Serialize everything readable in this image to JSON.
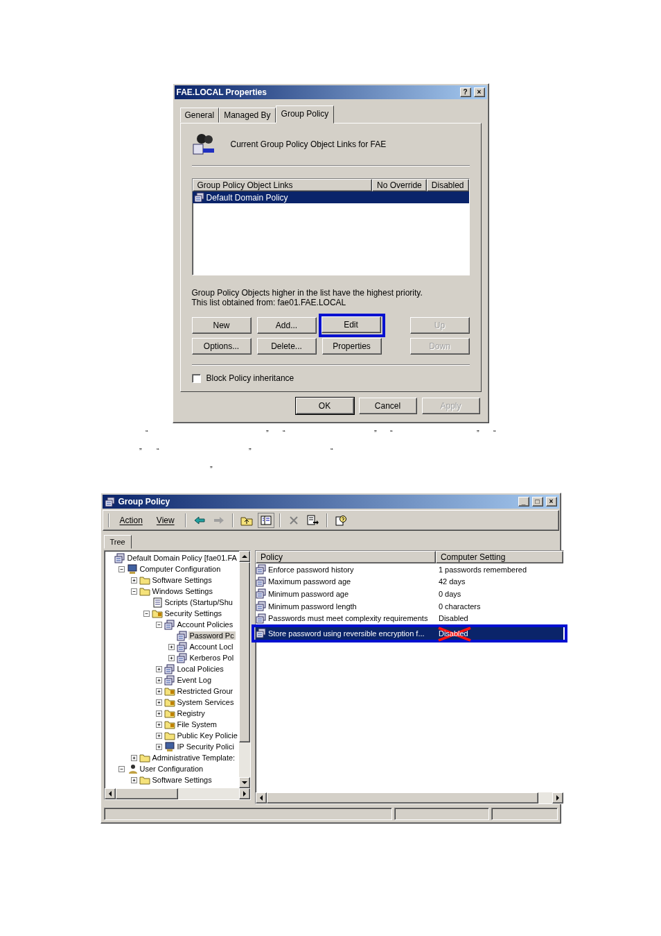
{
  "dialog": {
    "title": "FAE.LOCAL Properties",
    "title_buttons": [
      "?",
      "×"
    ],
    "tabs": [
      {
        "label": "General",
        "selected": false
      },
      {
        "label": "Managed By",
        "selected": false
      },
      {
        "label": "Group Policy",
        "selected": true
      }
    ],
    "heading": "Current Group Policy Object Links for FAE",
    "links_table": {
      "columns": [
        "Group Policy Object Links",
        "No Override",
        "Disabled"
      ],
      "rows": [
        {
          "name": "Default Domain Policy",
          "selected": true
        }
      ]
    },
    "notes": [
      "Group Policy Objects higher in the list have the highest priority.",
      "This list obtained from: fae01.FAE.LOCAL"
    ],
    "button_rows": [
      [
        {
          "label": "New",
          "disabled": false
        },
        {
          "label": "Add...",
          "disabled": false
        },
        {
          "label": "Edit",
          "disabled": false,
          "annotated": true
        },
        {
          "label": "Up",
          "disabled": true
        }
      ],
      [
        {
          "label": "Options...",
          "disabled": false
        },
        {
          "label": "Delete...",
          "disabled": false
        },
        {
          "label": "Properties",
          "disabled": false
        },
        {
          "label": "Down",
          "disabled": true
        }
      ]
    ],
    "block_inheritance": {
      "label": "Block Policy inheritance",
      "checked": false
    },
    "footer_buttons": [
      {
        "label": "OK",
        "default": true,
        "disabled": false
      },
      {
        "label": "Cancel",
        "default": false,
        "disabled": false
      },
      {
        "label": "Apply",
        "default": false,
        "disabled": true
      }
    ]
  },
  "quote_lines": [
    [
      "“",
      "”",
      "“",
      "”",
      "“",
      "”",
      "“"
    ],
    [
      "”",
      "“",
      "”",
      "“"
    ],
    [
      "”"
    ]
  ],
  "gp_window": {
    "title": "Group Policy",
    "title_buttons": [
      "_",
      "□",
      "×"
    ],
    "menu": [
      "Action",
      "View"
    ],
    "tree_tab": "Tree",
    "tree": [
      {
        "label": "Default Domain Policy [fae01.FA",
        "kind": "policy",
        "selected": false,
        "children": [
          {
            "label": "Computer Configuration",
            "kind": "computer",
            "expanded": true,
            "selected": false,
            "children": [
              {
                "label": "Software Settings",
                "kind": "folder",
                "expanded": false,
                "selected": false
              },
              {
                "label": "Windows Settings",
                "kind": "folder",
                "expanded": true,
                "selected": false,
                "children": [
                  {
                    "label": "Scripts (Startup/Shu",
                    "kind": "script",
                    "selected": false
                  },
                  {
                    "label": "Security Settings",
                    "kind": "secure",
                    "expanded": true,
                    "selected": false,
                    "children": [
                      {
                        "label": "Account Policies",
                        "kind": "policy",
                        "expanded": true,
                        "selected": false,
                        "children": [
                          {
                            "label": "Password Pc",
                            "kind": "policy",
                            "selected": true
                          },
                          {
                            "label": "Account Locl",
                            "kind": "policy",
                            "expanded": false,
                            "selected": false
                          },
                          {
                            "label": "Kerberos Pol",
                            "kind": "policy",
                            "expanded": false,
                            "selected": false
                          }
                        ]
                      },
                      {
                        "label": "Local Policies",
                        "kind": "policy",
                        "expanded": false,
                        "selected": false
                      },
                      {
                        "label": "Event Log",
                        "kind": "policy",
                        "expanded": false,
                        "selected": false
                      },
                      {
                        "label": "Restricted Grour",
                        "kind": "secure",
                        "expanded": false,
                        "selected": false
                      },
                      {
                        "label": "System Services",
                        "kind": "secure",
                        "expanded": false,
                        "selected": false
                      },
                      {
                        "label": "Registry",
                        "kind": "secure",
                        "expanded": false,
                        "selected": false
                      },
                      {
                        "label": "File System",
                        "kind": "secure",
                        "expanded": false,
                        "selected": false
                      },
                      {
                        "label": "Public Key Policie",
                        "kind": "folder",
                        "expanded": false,
                        "selected": false
                      },
                      {
                        "label": "IP Security Polici",
                        "kind": "computer",
                        "expanded": false,
                        "selected": false
                      }
                    ]
                  }
                ]
              },
              {
                "label": "Administrative Template:",
                "kind": "folder",
                "expanded": false,
                "selected": false
              }
            ]
          },
          {
            "label": "User Configuration",
            "kind": "user",
            "expanded": true,
            "selected": false,
            "children": [
              {
                "label": "Software Settings",
                "kind": "folder",
                "expanded": false,
                "selected": false
              }
            ]
          }
        ]
      }
    ],
    "columns": [
      "Policy",
      "Computer Setting"
    ],
    "policies": [
      {
        "policy": "Enforce password history",
        "setting": "1 passwords remembered",
        "selected": false
      },
      {
        "policy": "Maximum password age",
        "setting": "42 days",
        "selected": false
      },
      {
        "policy": "Minimum password age",
        "setting": "0 days",
        "selected": false
      },
      {
        "policy": "Minimum password length",
        "setting": "0 characters",
        "selected": false
      },
      {
        "policy": "Passwords must meet complexity requirements",
        "setting": "Disabled",
        "selected": false
      },
      {
        "policy": "Store password using reversible encryption f...",
        "setting": "Disabled",
        "selected": true,
        "annotated": true
      }
    ]
  }
}
